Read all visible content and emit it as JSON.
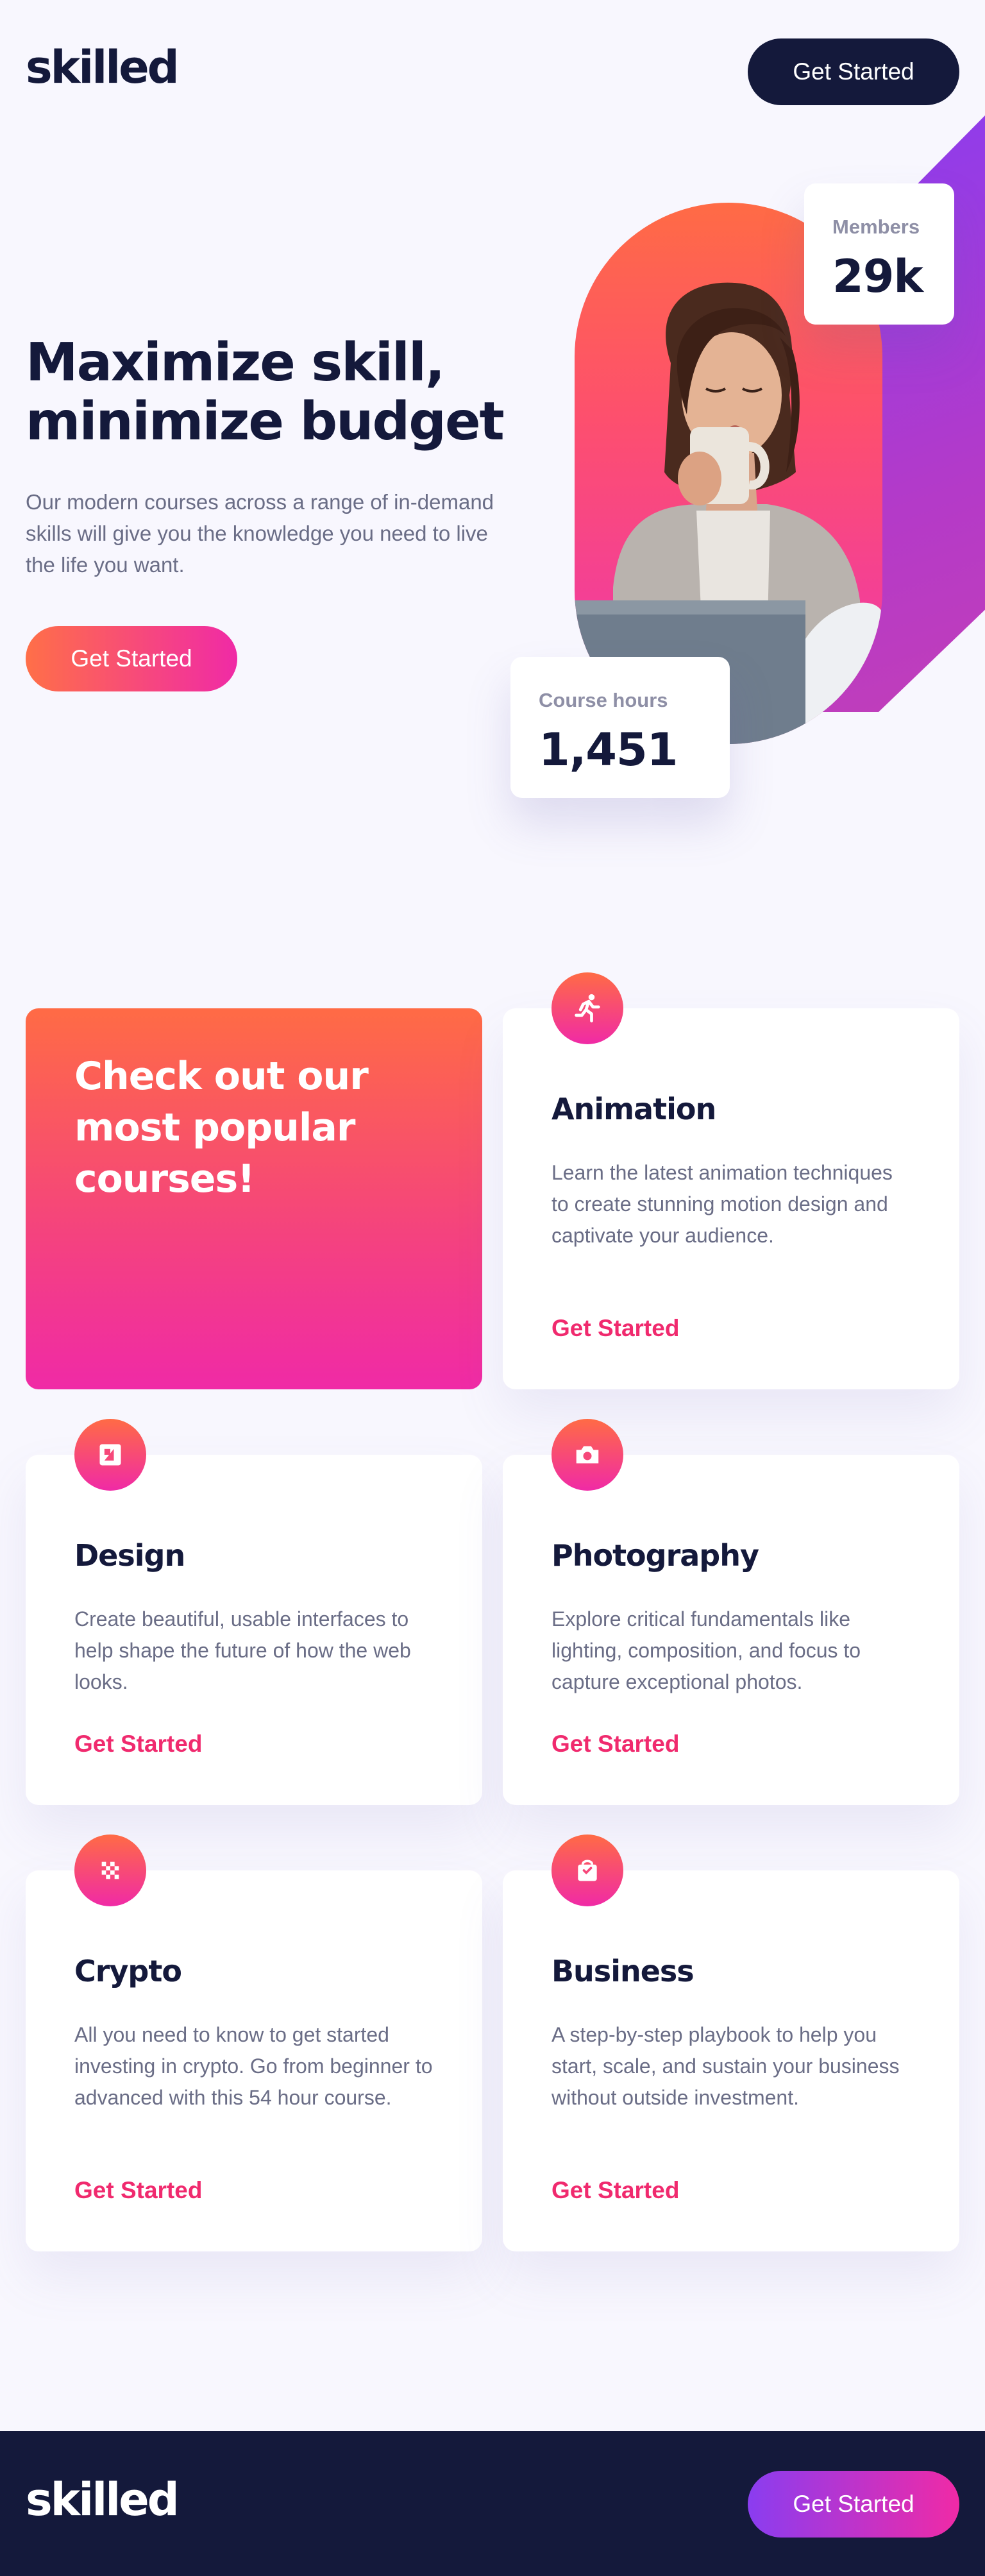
{
  "header": {
    "logo": "skilled",
    "cta_label": "Get Started"
  },
  "hero": {
    "title": "Maximize skill, minimize budget",
    "description": "Our modern courses across a range of in-demand skills will give you the knowledge you need to live the life you want.",
    "cta_label": "Get Started",
    "stats": {
      "members_label": "Members",
      "members_value": "29k",
      "hours_label": "Course hours",
      "hours_value": "1,451"
    }
  },
  "courses": {
    "promo_title": "Check out our most popular courses!",
    "items": [
      {
        "icon": "running-person-icon",
        "title": "Animation",
        "description": "Learn the latest animation techniques to create stunning motion design and captivate your audience.",
        "link_label": "Get Started"
      },
      {
        "icon": "design-icon",
        "title": "Design",
        "description": "Create beautiful, usable interfaces to help shape the future of how the web looks.",
        "link_label": "Get Started"
      },
      {
        "icon": "camera-icon",
        "title": "Photography",
        "description": "Explore critical fundamentals like lighting, composition, and focus to capture exceptional photos.",
        "link_label": "Get Started"
      },
      {
        "icon": "crypto-icon",
        "title": "Crypto",
        "description": "All you need to know to get started investing in crypto. Go from beginner to advanced with this 54 hour course.",
        "link_label": "Get Started"
      },
      {
        "icon": "shopping-bag-icon",
        "title": "Business",
        "description": "A step-by-step playbook to help you start, scale, and sustain your business without outside investment.",
        "link_label": "Get Started"
      }
    ]
  },
  "footer": {
    "logo": "skilled",
    "cta_label": "Get Started"
  },
  "colors": {
    "navy": "#14193b",
    "orange": "#ff6f48",
    "pink": "#f02aa6",
    "purple": "#8a3df0",
    "link": "#f02a6e"
  }
}
